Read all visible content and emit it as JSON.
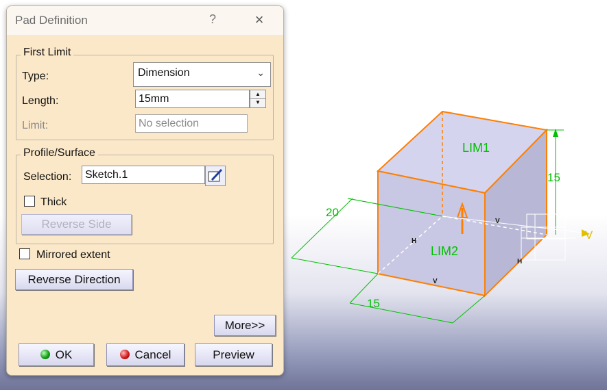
{
  "dialog": {
    "title": "Pad Definition",
    "help_label": "?",
    "close_label": "×",
    "first_limit": {
      "legend": "First Limit",
      "type_label": "Type:",
      "type_value": "Dimension",
      "length_label": "Length:",
      "length_value": "15mm",
      "limit_label": "Limit:",
      "limit_value": "No selection"
    },
    "profile_surface": {
      "legend": "Profile/Surface",
      "selection_label": "Selection:",
      "selection_value": "Sketch.1",
      "thick_label": "Thick",
      "thick_checked": false,
      "reverse_side_label": "Reverse Side"
    },
    "mirrored_extent_label": "Mirrored extent",
    "mirrored_extent_checked": false,
    "reverse_direction_label": "Reverse Direction",
    "more_label": "More>>",
    "ok_label": "OK",
    "cancel_label": "Cancel",
    "preview_label": "Preview"
  },
  "viewport": {
    "face_labels": [
      "LIM1",
      "LIM2"
    ],
    "dimensions": [
      "15",
      "20",
      "15"
    ],
    "axis_label": "V",
    "constraint_marks": [
      "H",
      "V",
      "H",
      "V"
    ],
    "colors": {
      "edge": "#ff7f00",
      "dimension": "#00c000",
      "face": "#c9c9ea"
    }
  }
}
